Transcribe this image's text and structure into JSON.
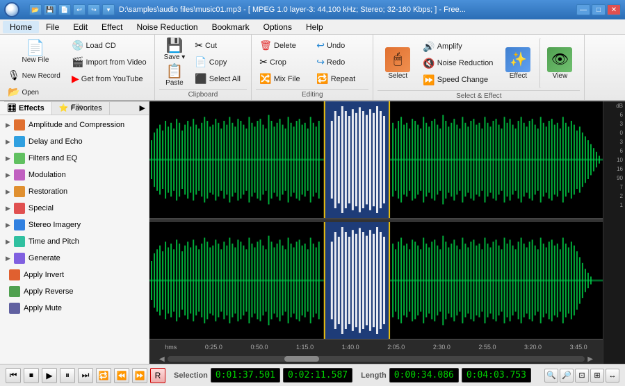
{
  "titlebar": {
    "title": "D:\\samples\\audio files\\music01.mp3 - [ MPEG 1.0 layer-3: 44,100 kHz; Stereo; 32-160 Kbps; ] - Free...",
    "logo_alt": "app-logo",
    "controls": [
      "—",
      "□",
      "✕"
    ]
  },
  "toolbar_mini": [
    "⬅",
    "➡",
    "⬆",
    "⬇",
    "🔃",
    "🔃",
    "▾"
  ],
  "menubar": {
    "items": [
      "Home",
      "File",
      "Edit",
      "Effect",
      "Noise Reduction",
      "Bookmark",
      "Options",
      "Help"
    ]
  },
  "ribbon": {
    "groups": [
      {
        "label": "File",
        "buttons_large": [
          {
            "id": "new-file",
            "icon": "📄",
            "label": "New File"
          },
          {
            "id": "new-record",
            "icon": "🎙",
            "label": "New Record"
          },
          {
            "id": "open",
            "icon": "📂",
            "label": "Open"
          }
        ],
        "buttons_small": [
          {
            "id": "load-cd",
            "icon": "💿",
            "label": "Load CD"
          },
          {
            "id": "import-video",
            "icon": "🎬",
            "label": "Import from Video"
          },
          {
            "id": "get-youtube",
            "icon": "▶",
            "label": "Get from YouTube"
          }
        ]
      },
      {
        "label": "Clipboard",
        "buttons_large": [
          {
            "id": "save",
            "icon": "💾",
            "label": "Save"
          },
          {
            "id": "paste",
            "icon": "📋",
            "label": "Paste"
          }
        ],
        "buttons_small": [
          {
            "id": "cut",
            "icon": "✂",
            "label": "Cut"
          },
          {
            "id": "copy",
            "icon": "📄",
            "label": "Copy"
          },
          {
            "id": "select-all",
            "icon": "⬛",
            "label": "Select All"
          }
        ]
      },
      {
        "label": "Editing",
        "buttons_small_all": [
          {
            "id": "delete",
            "icon": "🗑",
            "label": "Delete"
          },
          {
            "id": "crop",
            "icon": "✂",
            "label": "Crop"
          },
          {
            "id": "mix-file",
            "icon": "🔀",
            "label": "Mix File"
          },
          {
            "id": "undo",
            "icon": "↩",
            "label": "Undo"
          },
          {
            "id": "redo",
            "icon": "↪",
            "label": "Redo"
          },
          {
            "id": "repeat",
            "icon": "🔁",
            "label": "Repeat"
          }
        ]
      },
      {
        "label": "Select & Effect",
        "select_label": "Select",
        "effect_label": "Effect",
        "view_label": "View",
        "small_btns": [
          {
            "id": "amplify",
            "icon": "🔊",
            "label": "Amplify"
          },
          {
            "id": "noise-reduction",
            "icon": "🔇",
            "label": "Noise Reduction"
          },
          {
            "id": "speed-change",
            "icon": "⏩",
            "label": "Speed Change"
          }
        ]
      }
    ]
  },
  "leftpanel": {
    "tabs": [
      "Effects",
      "Favorites"
    ],
    "effects": [
      {
        "id": "amplitude",
        "label": "Amplitude and Compression",
        "color": "#e07030"
      },
      {
        "id": "delay",
        "label": "Delay and Echo",
        "color": "#30a0e0"
      },
      {
        "id": "filters",
        "label": "Filters and EQ",
        "color": "#60c060"
      },
      {
        "id": "modulation",
        "label": "Modulation",
        "color": "#c060c0"
      },
      {
        "id": "restoration",
        "label": "Restoration",
        "color": "#e09030"
      },
      {
        "id": "special",
        "label": "Special",
        "color": "#e05050"
      },
      {
        "id": "stereo",
        "label": "Stereo Imagery",
        "color": "#3080e0"
      },
      {
        "id": "timepitch",
        "label": "Time and Pitch",
        "color": "#30c0a0"
      },
      {
        "id": "generate",
        "label": "Generate",
        "color": "#8060e0"
      },
      {
        "id": "invert",
        "label": "Apply Invert",
        "color": "#e06030"
      },
      {
        "id": "reverse",
        "label": "Apply Reverse",
        "color": "#50a050"
      },
      {
        "id": "mute",
        "label": "Apply Mute",
        "color": "#6060a0"
      }
    ]
  },
  "timeline": {
    "marks": [
      "0:25.0",
      "0:50.0",
      "1:15.0",
      "1:40.0",
      "2:05.0",
      "2:30.0",
      "2:55.0",
      "3:20.0",
      "3:45.0"
    ]
  },
  "transport": {
    "buttons": [
      "⏮",
      "⏹",
      "⏵",
      "⏺",
      "⏭",
      "⏸",
      "⏯",
      "⏩",
      "⏪"
    ],
    "record_btn": "R",
    "selection_label": "Selection",
    "sel_start": "0:01:37.501",
    "sel_end": "0:02:11.587",
    "length_label": "Length",
    "len_start": "0:00:34.086",
    "len_end": "0:04:03.753"
  },
  "db_labels": [
    "dB",
    "6",
    "3",
    "0",
    "3",
    "6",
    "10",
    "16",
    "90",
    "7",
    "2",
    "1"
  ]
}
